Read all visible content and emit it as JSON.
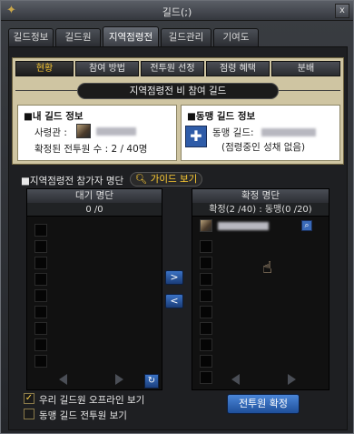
{
  "window": {
    "title": "길드(;)",
    "close_label": "x"
  },
  "tabs": [
    {
      "label": "길드정보"
    },
    {
      "label": "길드원"
    },
    {
      "label": "지역점령전"
    },
    {
      "label": "길드관리"
    },
    {
      "label": "기여도"
    }
  ],
  "active_tab": "지역점령전",
  "subtabs": [
    {
      "label": "현황"
    },
    {
      "label": "참여 방법"
    },
    {
      "label": "전투원 선정"
    },
    {
      "label": "점령 혜택"
    },
    {
      "label": "분배"
    }
  ],
  "active_subtab": "현황",
  "banner": "지역점령전 비 참여 길드",
  "my_guild": {
    "header": "■내 길드 정보",
    "commander_label": "사령관 :",
    "fighters_line": "확정된 전투원 수 : 2 / 40명"
  },
  "ally_guild": {
    "header": "■동맹 길드 정보",
    "ally_label": "동맹 길드:",
    "status": "(점령중인 성채 없음)"
  },
  "participants": {
    "header": "■지역점령전 참가자 명단",
    "guide_button": "가이드 보기"
  },
  "waiting_list": {
    "title": "대기 명단",
    "count": "0 /0"
  },
  "confirmed_list": {
    "title": "확정 명단",
    "count": "확정(2 /40) : 동맹(0 /20)"
  },
  "controls": {
    "move_right": ">",
    "move_left": "<",
    "refresh": "↻"
  },
  "options": {
    "show_offline": "우리 길드원 오프라인 보기",
    "show_offline_checked": true,
    "show_ally_fighters": "동맹 길드 전투원 보기",
    "show_ally_fighters_checked": false
  },
  "confirm_button": "전투원 확정",
  "colors": {
    "gold_panel": "#cfc5a2",
    "active_subtab_text": "#ffcc33",
    "button_blue": "#2f5ca8"
  }
}
